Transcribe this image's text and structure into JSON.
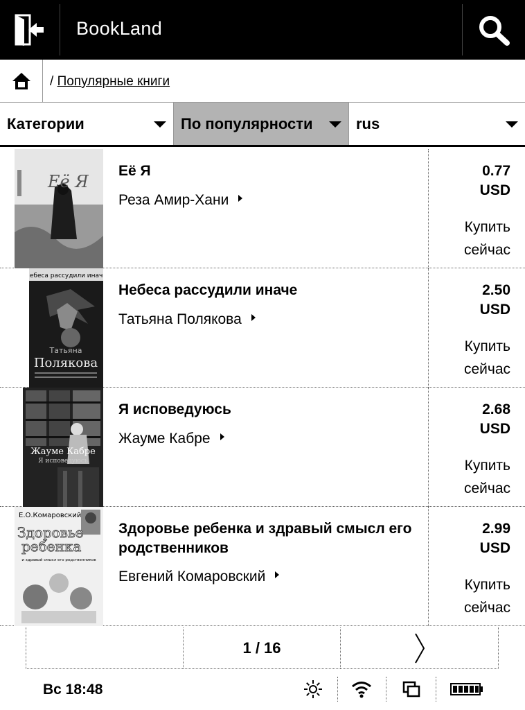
{
  "header": {
    "app_title": "BookLand"
  },
  "breadcrumb": {
    "separator": "/",
    "current": "Популярные книги"
  },
  "filters": [
    {
      "label": "Категории",
      "selected": false
    },
    {
      "label": "По популярности",
      "selected": true
    },
    {
      "label": "rus",
      "selected": false
    }
  ],
  "books": [
    {
      "title": "Её Я",
      "author": "Реза Амир-Хани",
      "price": "0.77",
      "currency": "USD",
      "buy_line1": "Купить",
      "buy_line2": "сейчас"
    },
    {
      "title": "Небеса рассудили иначе",
      "author": "Татьяна Полякова",
      "price": "2.50",
      "currency": "USD",
      "buy_line1": "Купить",
      "buy_line2": "сейчас"
    },
    {
      "title": "Я исповедуюсь",
      "author": "Жауме Кабре",
      "price": "2.68",
      "currency": "USD",
      "buy_line1": "Купить",
      "buy_line2": "сейчас"
    },
    {
      "title": "Здоровье ребенка и здравый смысл его родственников",
      "author": "Евгений Комаровский",
      "price": "2.99",
      "currency": "USD",
      "buy_line1": "Купить",
      "buy_line2": "сейчас"
    }
  ],
  "covers": {
    "c1_title": "Её Я",
    "c2_top": "Небеса рассудили иначе",
    "c2_name1": "Татьяна",
    "c2_name2": "Полякова",
    "c3_name": "Жауме Кабре",
    "c3_title": "Я исповедуюсь",
    "c4_author": "Е.О.Комаровский",
    "c4_big1": "Здоровье",
    "c4_big2": "ребенка",
    "c4_sub": "и здравый смысл его родственников"
  },
  "pagination": {
    "page_label": "1 / 16"
  },
  "status_bar": {
    "time": "Вс 18:48",
    "icons": [
      "brightness-icon",
      "wifi-icon",
      "tasks-icon",
      "battery-icon"
    ]
  }
}
